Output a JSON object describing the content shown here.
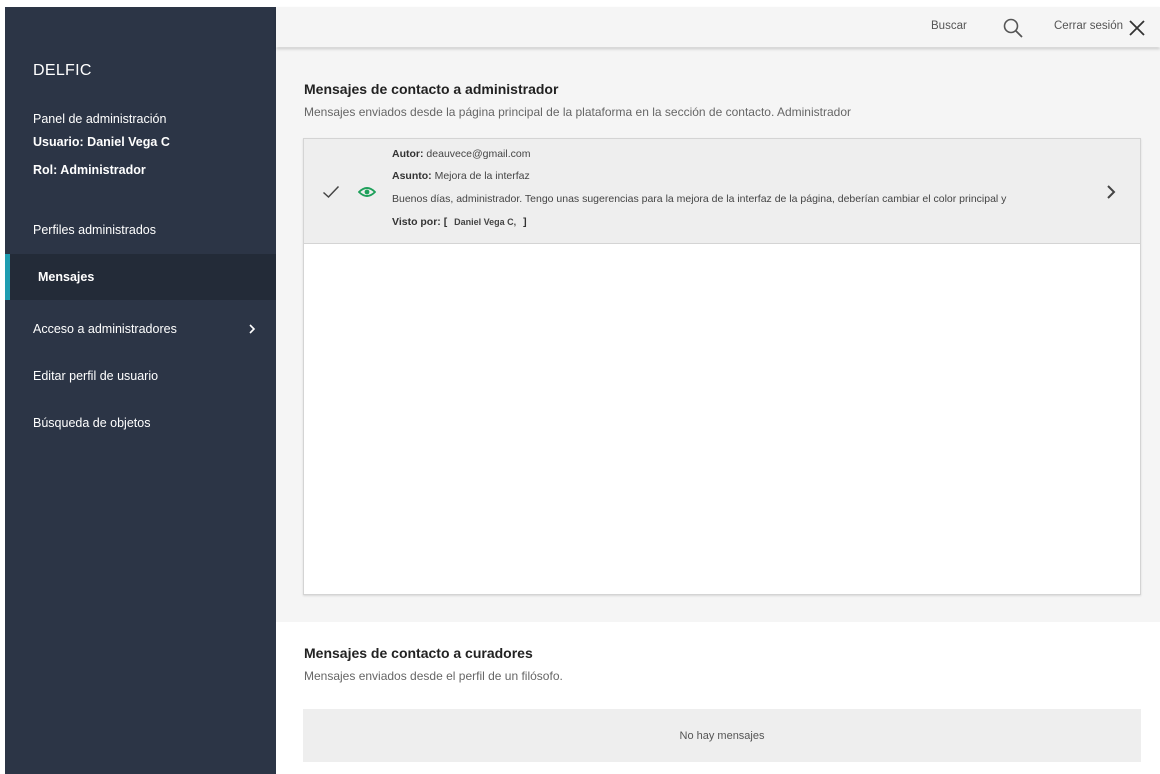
{
  "sidebar": {
    "brand": "DELFIC",
    "panel_title": "Panel de administración",
    "user": "Usuario: Daniel Vega C",
    "role": "Rol: Administrador",
    "items": [
      {
        "label": "Perfiles administrados",
        "active": false
      },
      {
        "label": "Mensajes",
        "active": true
      },
      {
        "label": "Acceso a administradores",
        "active": false,
        "has_submenu": true
      },
      {
        "label": "Editar perfil de usuario",
        "active": false
      },
      {
        "label": "Búsqueda de objetos",
        "active": false
      }
    ]
  },
  "topbar": {
    "search_label": "Buscar",
    "logout_label": "Cerrar sesión"
  },
  "admin_messages": {
    "title": "Mensajes de contacto a administrador",
    "description": "Mensajes enviados desde la página principal de la plataforma en la sección de contacto. Administrador",
    "messages": [
      {
        "author_label": "Autor:",
        "author": "deauvece@gmail.com",
        "subject_label": "Asunto:",
        "subject": "Mejora de la interfaz",
        "body": "Buenos días, administrador. Tengo unas sugerencias para la mejora de la interfaz de la página, deberían cambiar el color principal y",
        "seen_label": "Visto por:",
        "seen_open": "[",
        "seen_by": "Daniel Vega C,",
        "seen_close": "]"
      }
    ]
  },
  "curator_messages": {
    "title": "Mensajes de contacto a curadores",
    "description": "Mensajes enviados desde el perfil de un filósofo.",
    "empty_text": "No hay mensajes"
  },
  "colors": {
    "sidebar_bg": "#2c3546",
    "sidebar_active_bg": "#232b38",
    "active_accent": "#1e9cb0",
    "seen_icon": "#1ea05a",
    "panel_bg": "#f5f5f5"
  }
}
